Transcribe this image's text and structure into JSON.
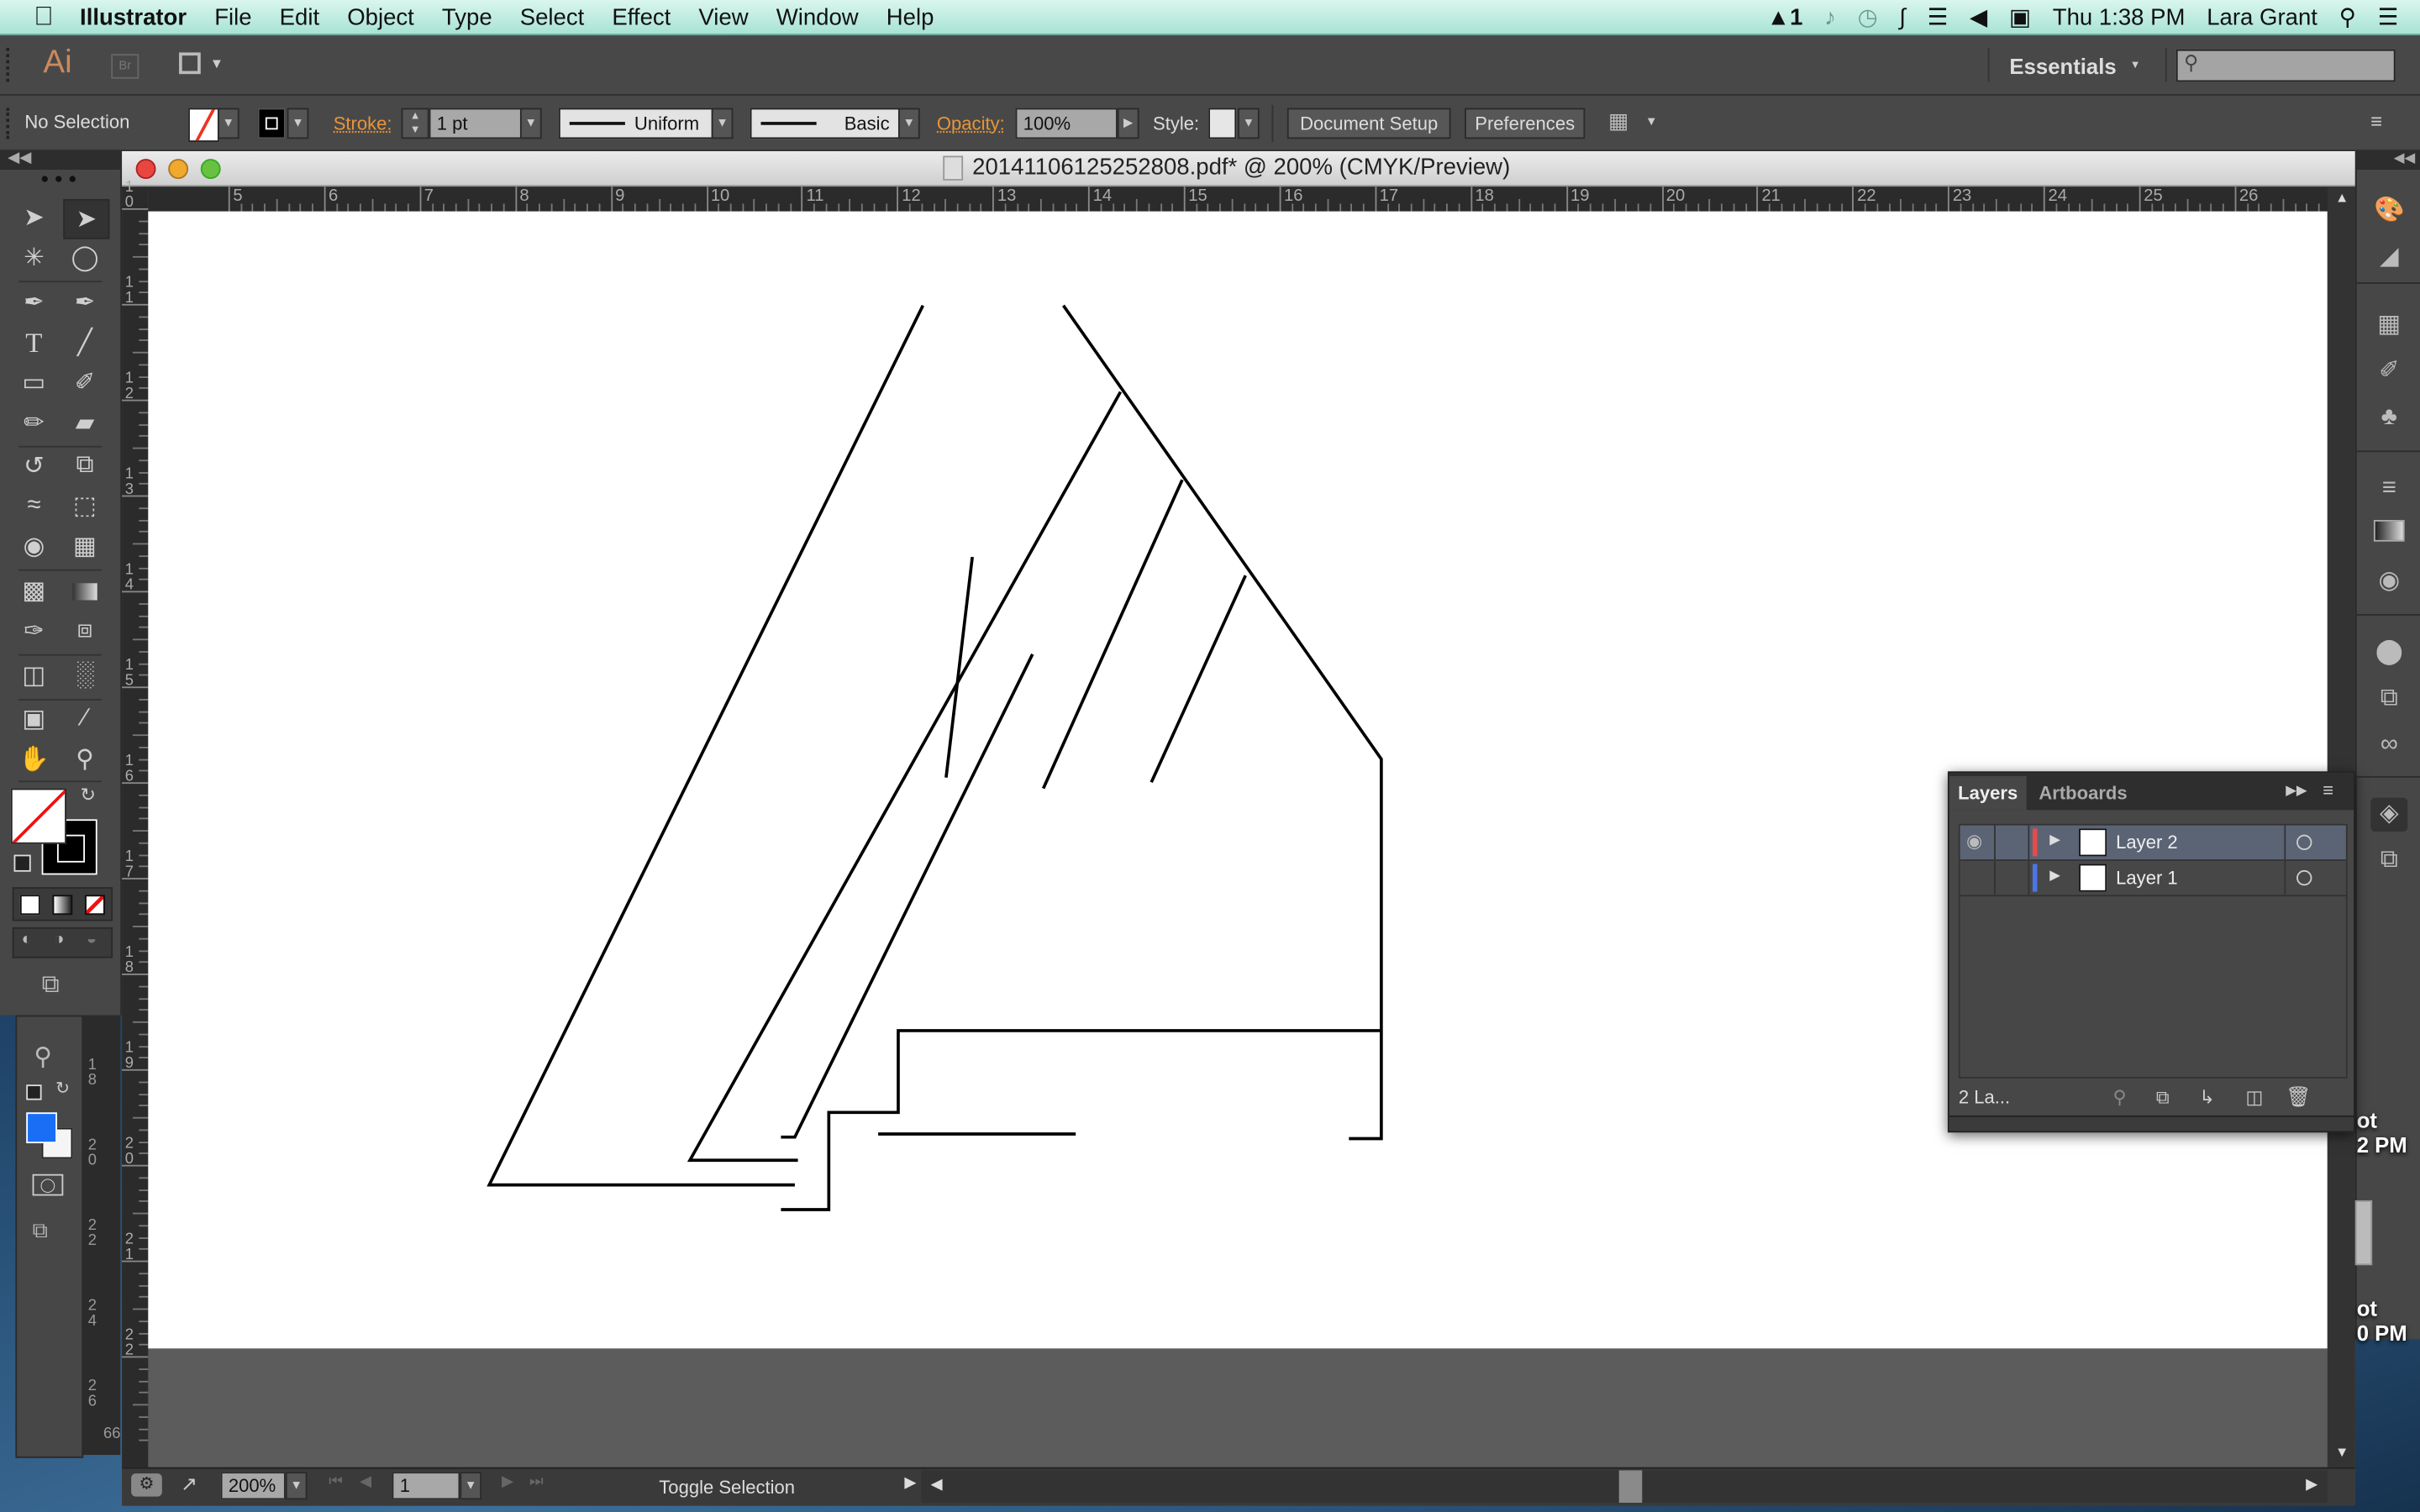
{
  "menubar": {
    "app_name": "Illustrator",
    "items": [
      "File",
      "Edit",
      "Object",
      "Type",
      "Select",
      "Effect",
      "View",
      "Window",
      "Help"
    ],
    "status": {
      "adobe_count": "1",
      "clock": "Thu 1:38 PM",
      "user": "Lara Grant"
    },
    "icons": [
      "adobe-icon",
      "notification-icon",
      "time-machine-icon",
      "bluetooth-icon",
      "wifi-icon",
      "volume-icon",
      "battery-icon",
      "spotlight-icon",
      "notification-center-icon"
    ]
  },
  "appbar": {
    "logo": "Ai",
    "bridge": "Br",
    "workspace": "Essentials",
    "search_placeholder": ""
  },
  "control": {
    "selection": "No Selection",
    "stroke_label": "Stroke:",
    "stroke_weight": "1 pt",
    "profile": "Uniform",
    "brush": "Basic",
    "opacity_label": "Opacity:",
    "opacity": "100%",
    "style_label": "Style:",
    "document_setup": "Document Setup",
    "preferences": "Preferences"
  },
  "document": {
    "title": "20141106125252808.pdf* @ 200% (CMYK/Preview)",
    "h_ruler": [
      "5",
      "6",
      "7",
      "8",
      "9",
      "10",
      "11",
      "12",
      "13",
      "14",
      "15",
      "16",
      "17",
      "18",
      "19",
      "20",
      "21",
      "22",
      "23",
      "24",
      "25",
      "26"
    ],
    "v_ruler": [
      "10",
      "11",
      "12",
      "13",
      "14",
      "15",
      "16",
      "17",
      "18",
      "19",
      "20",
      "21",
      "22"
    ],
    "colors": {
      "fill": "none",
      "stroke": "#000000"
    }
  },
  "statusbar": {
    "zoom": "200%",
    "artboard": "1",
    "status_text": "Toggle Selection"
  },
  "tools_panel_lower": {
    "fill_color": "#1a6ef5",
    "ruler_labels": [
      "18",
      "20",
      "22",
      "24",
      "26"
    ],
    "bottom_value": "66"
  },
  "layers_panel": {
    "tabs": [
      "Layers",
      "Artboards"
    ],
    "active_tab": "Layers",
    "layers": [
      {
        "name": "Layer 2",
        "color": "#e84a4a",
        "visible": true,
        "selected": true
      },
      {
        "name": "Layer 1",
        "color": "#4a76e8",
        "visible": false,
        "selected": false
      }
    ],
    "count_label": "2 La..."
  },
  "desktop": {
    "labels": [
      {
        "line1": "ot",
        "line2": "2 PM"
      },
      {
        "line1": "ot",
        "line2": "0 PM"
      }
    ]
  }
}
